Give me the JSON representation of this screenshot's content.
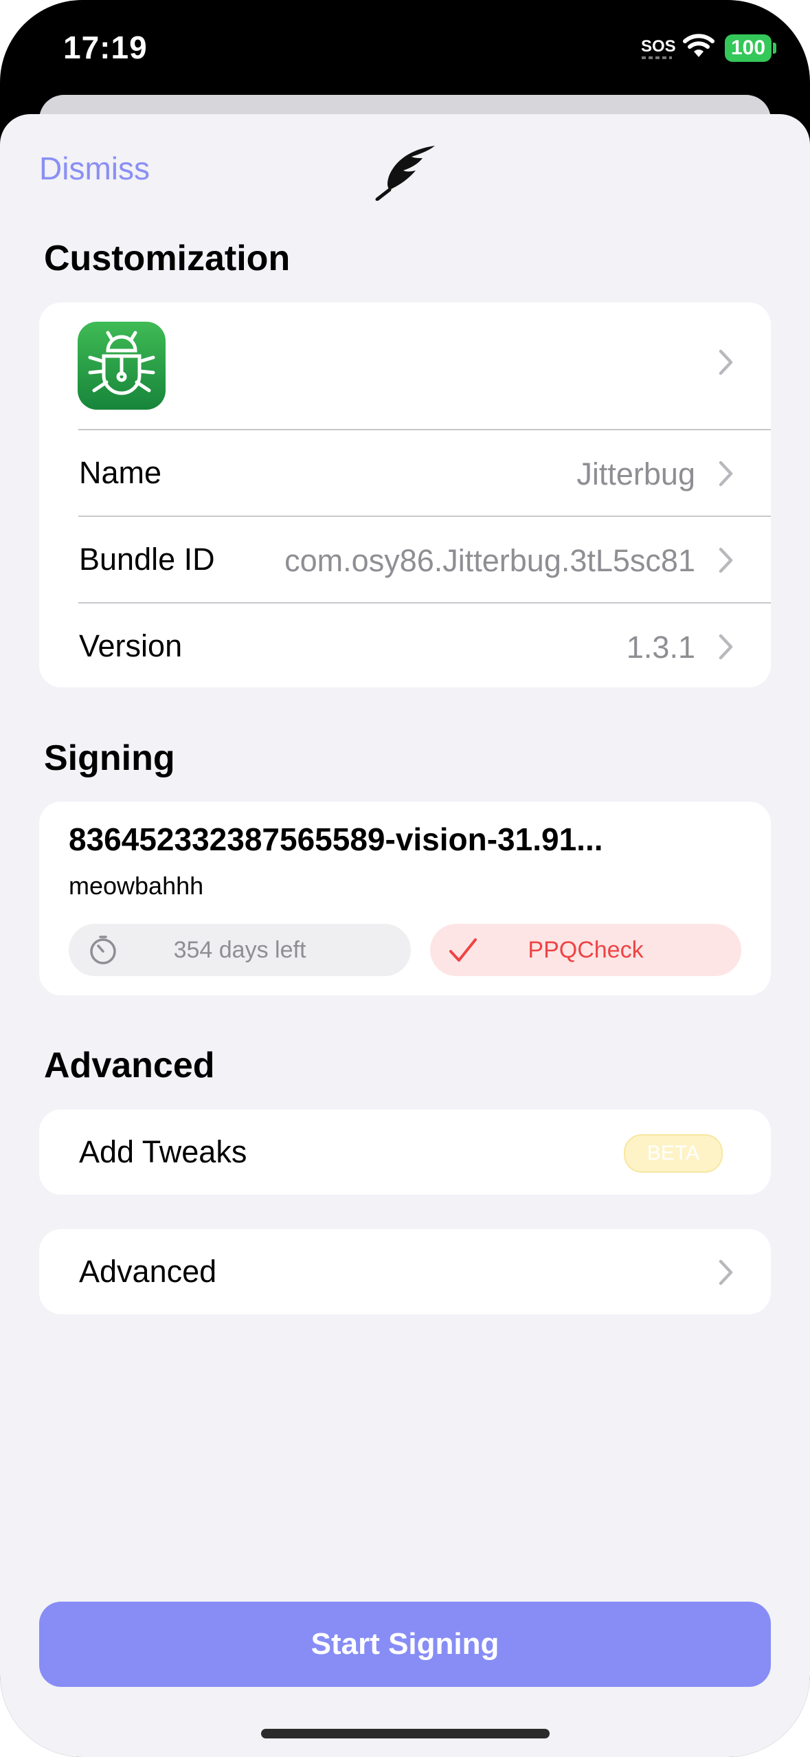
{
  "status_bar": {
    "time": "17:19",
    "sos": "SOS",
    "battery": "100"
  },
  "header": {
    "dismiss_label": "Dismiss",
    "logo_icon": "quill-icon"
  },
  "customization": {
    "title": "Customization",
    "rows": [
      {
        "label": "Name",
        "value": "Jitterbug"
      },
      {
        "label": "Bundle ID",
        "value": "com.osy86.Jitterbug.3tL5sc81"
      },
      {
        "label": "Version",
        "value": "1.3.1"
      }
    ]
  },
  "signing": {
    "title": "Signing",
    "certificate_name": "836452332387565589-vision-31.91...",
    "certificate_subtitle": "meowbahhh",
    "expiry": "354 days left",
    "status": "PPQCheck"
  },
  "advanced": {
    "title": "Advanced",
    "add_tweaks_label": "Add Tweaks",
    "beta_badge": "BETA",
    "advanced_label": "Advanced"
  },
  "start_button": "Start Signing",
  "colors": {
    "accent": "#878df5",
    "background": "#f2f2f7",
    "ppq_red": "#ef4444",
    "app_icon_green": "#2aa04a"
  }
}
